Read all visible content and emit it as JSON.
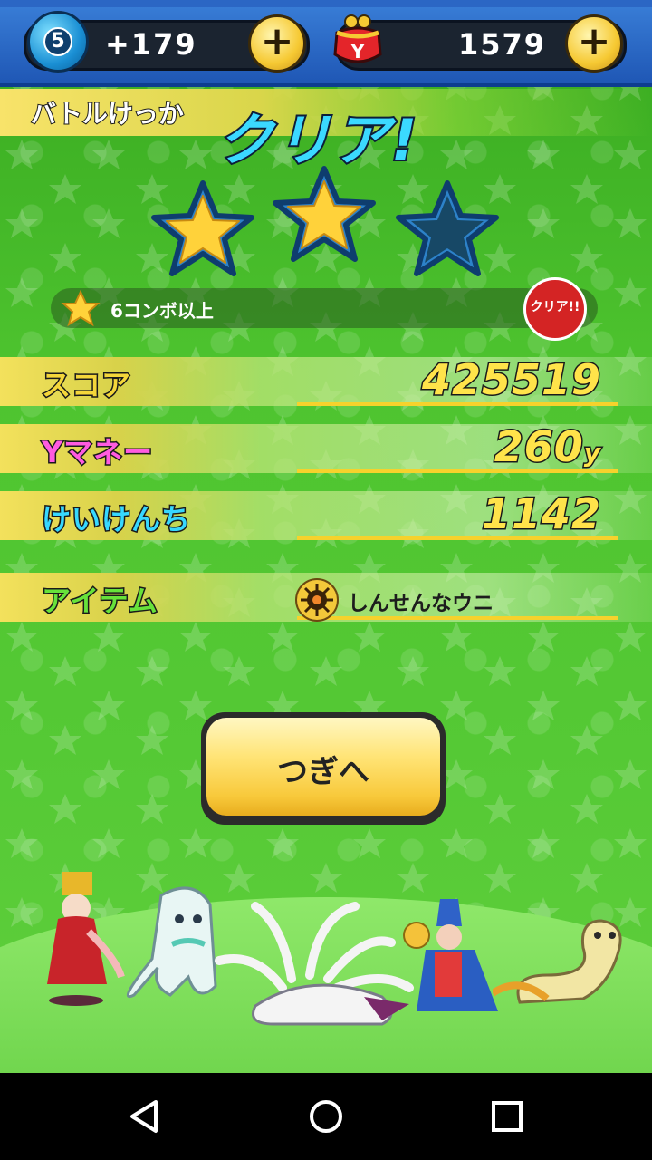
{
  "status_bar": {
    "orb_count": "5",
    "orb_plus": "+179",
    "money_amount": "1579",
    "add_orb_button": "+",
    "add_money_button": "+"
  },
  "result": {
    "header": "バトルけっか",
    "clear_text": "クリア!",
    "stars_earned": 2,
    "stars_total": 3,
    "condition": "6コンボ以上",
    "clear_badge": "クリア!!"
  },
  "stats": [
    {
      "label": "スコア",
      "value": "425519",
      "unit": "",
      "label_color": "#f4d63a"
    },
    {
      "label": "Yマネー",
      "value": "260",
      "unit": "y",
      "label_color": "#ff5be0"
    },
    {
      "label": "けいけんち",
      "value": "1142",
      "unit": "",
      "label_color": "#37d8ff"
    }
  ],
  "item": {
    "label": "アイテム",
    "name": "しんせんなウニ",
    "icon": "sea-urchin-icon"
  },
  "next_button": {
    "label": "つぎへ"
  },
  "characters": [
    "princess-character",
    "ghost-character",
    "white-fox-character",
    "knight-character",
    "snake-character"
  ],
  "nav": {
    "back": "back-icon",
    "home": "home-icon",
    "recents": "recents-icon"
  }
}
